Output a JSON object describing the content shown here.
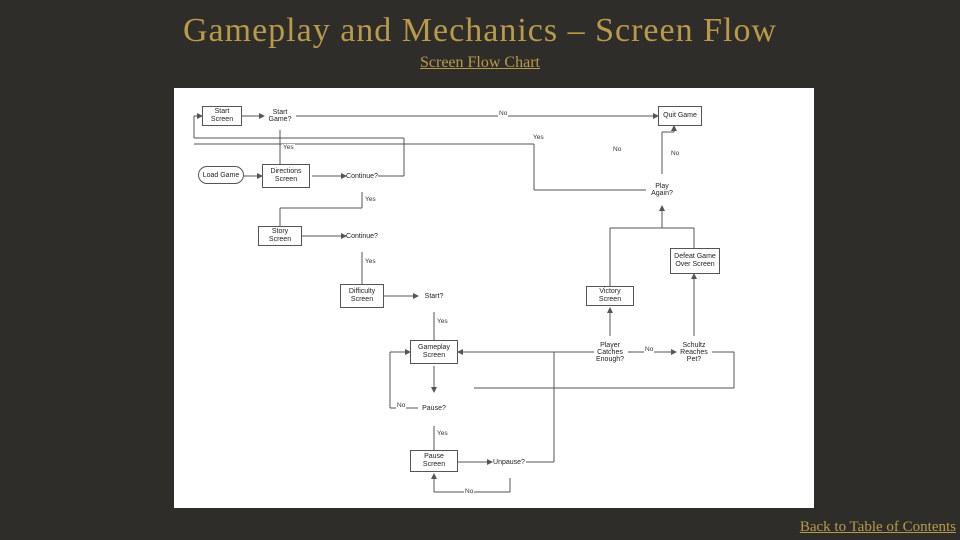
{
  "title": "Gameplay and Mechanics – Screen Flow",
  "subtitle": "Screen Flow Chart",
  "back_link": "Back to Table of Contents",
  "nodes": {
    "start_screen": "Start Screen",
    "start_game": "Start Game?",
    "quit_game": "Quit Game",
    "load_game": "Load Game",
    "directions_screen": "Directions Screen",
    "continue1": "Continue?",
    "story_screen": "Story Screen",
    "continue2": "Continue?",
    "difficulty_screen": "Difficulty Screen",
    "start": "Start?",
    "gameplay_screen": "Gameplay Screen",
    "pause": "Pause?",
    "pause_screen": "Pause Screen",
    "unpause": "Unpause?",
    "player_catches": "Player Catches Enough?",
    "schultz_reaches": "Schultz Reaches Pet?",
    "victory_screen": "Victory Screen",
    "defeat_screen": "Defeat Game Over Screen",
    "play_again": "Play Again?"
  },
  "labels": {
    "yes": "Yes",
    "no": "No"
  }
}
